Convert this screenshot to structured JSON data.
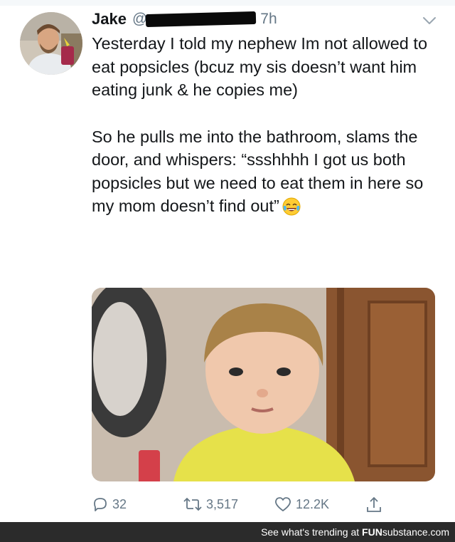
{
  "tweet": {
    "author_name": "Jake",
    "handle_prefix": "@",
    "time": "7h",
    "paragraphs": [
      "Yesterday I told my nephew Im not allowed to eat popsicles (bcuz my sis doesn’t want him eating junk & he copies me)",
      "So he pulls me into the bathroom, slams the door, and whispers: “ssshhhh I got us both popsicles but we need to eat them in here so my mom doesn’t find out”"
    ],
    "emoji_icon": "face-with-tears-of-joy-icon",
    "media_icon": "photo-boy-with-popsicle"
  },
  "actions": {
    "reply_count": "32",
    "retweet_count": "3,517",
    "like_count": "12.2K",
    "share_icon": "share-icon"
  },
  "footer": {
    "prefix": "See what's trending at ",
    "brand_fun": "FUN",
    "brand_rest": "substance.com"
  },
  "colors": {
    "text": "#14171a",
    "muted": "#657786",
    "footer_bg": "#2b2b2b"
  }
}
